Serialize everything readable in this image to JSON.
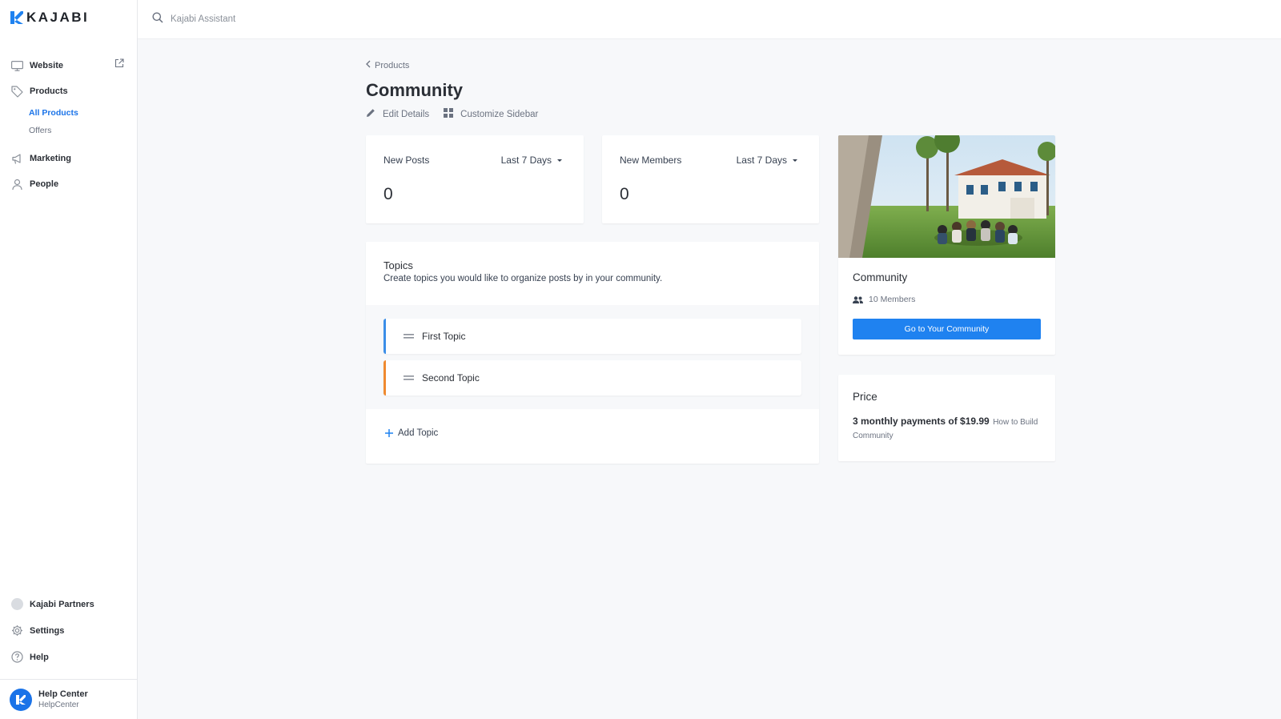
{
  "brand": {
    "name": "KAJABI"
  },
  "topbar": {
    "search_placeholder": "Kajabi Assistant"
  },
  "sidebar": {
    "items": [
      {
        "label": "Website",
        "icon": "monitor-icon"
      },
      {
        "label": "Products",
        "icon": "tag-icon"
      },
      {
        "label": "Marketing",
        "icon": "megaphone-icon"
      },
      {
        "label": "People",
        "icon": "person-icon"
      }
    ],
    "products_sub": [
      {
        "label": "All Products",
        "active": true
      },
      {
        "label": "Offers",
        "active": false
      }
    ],
    "bottom": [
      {
        "label": "Kajabi Partners"
      },
      {
        "label": "Settings"
      },
      {
        "label": "Help"
      }
    ],
    "help_center": {
      "name": "Help Center",
      "sub": "HelpCenter"
    }
  },
  "page": {
    "breadcrumb": "Products",
    "title": "Community",
    "actions": {
      "edit": "Edit Details",
      "customize": "Customize Sidebar"
    }
  },
  "stats": [
    {
      "label": "New Posts",
      "range": "Last 7 Days",
      "value": "0"
    },
    {
      "label": "New Members",
      "range": "Last 7 Days",
      "value": "0"
    }
  ],
  "topics": {
    "title": "Topics",
    "description": "Create topics you would like to organize posts by in your community.",
    "items": [
      {
        "label": "First Topic",
        "color": "#3b8ee8"
      },
      {
        "label": "Second Topic",
        "color": "#ef8a2f"
      }
    ],
    "add_label": "Add Topic"
  },
  "community": {
    "title": "Community",
    "members": "10 Members",
    "button": "Go to Your Community"
  },
  "price": {
    "title": "Price",
    "main": "3 monthly payments of $19.99",
    "sub": "How to Build Community"
  },
  "colors": {
    "accent": "#1f82f0",
    "active_link": "#1a73e8"
  }
}
